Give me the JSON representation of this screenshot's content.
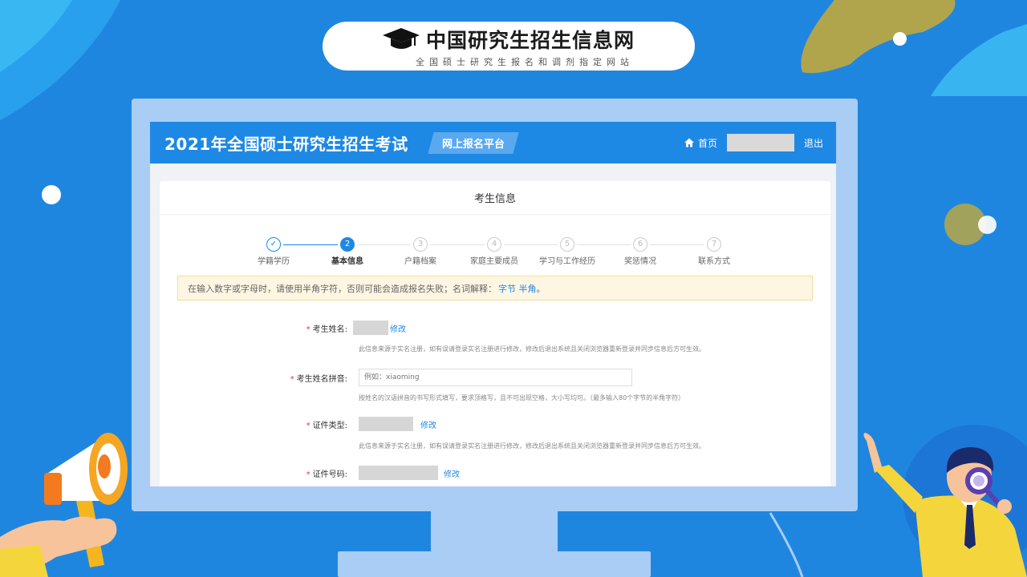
{
  "logo": {
    "title": "中国研究生招生信息网",
    "subtitle": "全国硕士研究生报名和调剂指定网站"
  },
  "topbar": {
    "exam_title": "2021年全国硕士研究生招生考试",
    "platform": "网上报名平台",
    "home": "首页",
    "logout": "退出"
  },
  "card": {
    "title": "考生信息"
  },
  "steps": [
    {
      "num": "✓",
      "label": "学籍学历",
      "state": "done"
    },
    {
      "num": "2",
      "label": "基本信息",
      "state": "active"
    },
    {
      "num": "3",
      "label": "户籍档案",
      "state": "todo"
    },
    {
      "num": "4",
      "label": "家庭主要成员",
      "state": "todo"
    },
    {
      "num": "5",
      "label": "学习与工作经历",
      "state": "todo"
    },
    {
      "num": "6",
      "label": "奖惩情况",
      "state": "todo"
    },
    {
      "num": "7",
      "label": "联系方式",
      "state": "todo"
    }
  ],
  "notice": {
    "text": "在输入数字或字母时，请使用半角字符，否则可能会造成报名失败；名词解释：",
    "link": "字节 半角",
    "end": "。"
  },
  "form": {
    "name_label": "考生姓名:",
    "name_edit": "修改",
    "name_hint": "此信息来源于实名注册，如有误请登录实名注册进行修改，修改后退出系统且关闭浏览器重新登录并同步信息后方可生效。",
    "pinyin_label": "考生姓名拼音:",
    "pinyin_placeholder": "例如：xiaoming",
    "pinyin_hint": "按姓名的汉语拼音的书写形式填写，要求顶格写，且不可出现空格，大小写均可。（最多输入80个字节的半角字符）",
    "idtype_label": "证件类型:",
    "idtype_edit": "修改",
    "idtype_hint": "此信息来源于实名注册，如有误请登录实名注册进行修改，修改后退出系统且关闭浏览器重新登录并同步信息后方可生效。",
    "idnum_label": "证件号码:",
    "idnum_edit": "修改",
    "required_mark": "*"
  },
  "colors": {
    "background": "#1f86e0",
    "topbar": "#1e88e5",
    "monitor": "#a9cdf5",
    "link": "#1e88e5",
    "required": "#e53935"
  },
  "icons": [
    "graduation-cap-icon",
    "home-icon",
    "megaphone-icon",
    "magnifier-icon"
  ]
}
